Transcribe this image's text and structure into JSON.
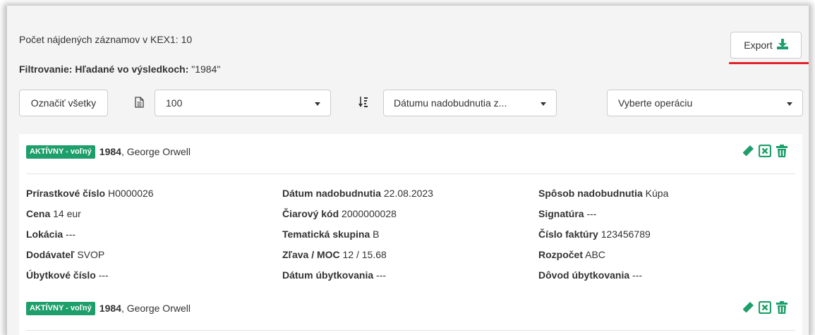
{
  "summary": {
    "count_text": "Počet nájdených záznamov v KEX1: 10",
    "filter_label": "Filtrovanie:",
    "filter_key": "Hľadané vo výsledkoch:",
    "filter_value": "\"1984\""
  },
  "toolbar": {
    "export_label": "Export",
    "select_all_label": "Označiť všetky",
    "page_size": "100",
    "sort_value": "Dátumu nadobudnutia z...",
    "operation_placeholder": "Vyberte operáciu"
  },
  "colors": {
    "accent_green": "#1e9e6a",
    "highlight_red": "#e0242a"
  },
  "icons": [
    "download-icon",
    "document-icon",
    "sort-icon",
    "edit-icon",
    "close-box-icon",
    "trash-icon"
  ],
  "records": [
    {
      "status": "AKTÍVNY - voľný",
      "title": "1984",
      "author": ", George Orwell",
      "fields": [
        [
          {
            "label": "Prírastkové číslo",
            "value": "H0000026"
          },
          {
            "label": "Dátum nadobudnutia",
            "value": "22.08.2023"
          },
          {
            "label": "Spôsob nadobudnutia",
            "value": "Kúpa"
          }
        ],
        [
          {
            "label": "Cena",
            "value": "14 eur"
          },
          {
            "label": "Čiarový kód",
            "value": "2000000028"
          },
          {
            "label": "Signatúra",
            "value": "---"
          }
        ],
        [
          {
            "label": "Lokácia",
            "value": "---"
          },
          {
            "label": "Tematická skupina",
            "value": "B"
          },
          {
            "label": "Číslo faktúry",
            "value": "123456789"
          }
        ],
        [
          {
            "label": "Dodávateľ",
            "value": "SVOP"
          },
          {
            "label": "Zľava / MOC",
            "value": "12 / 15.68"
          },
          {
            "label": "Rozpočet",
            "value": "ABC"
          }
        ],
        [
          {
            "label": "Úbytkové číslo",
            "value": "---"
          },
          {
            "label": "Dátum úbytkovania",
            "value": "---"
          },
          {
            "label": "Dôvod úbytkovania",
            "value": "---"
          }
        ]
      ]
    },
    {
      "status": "AKTÍVNY - voľný",
      "title": "1984",
      "author": ", George Orwell"
    }
  ]
}
